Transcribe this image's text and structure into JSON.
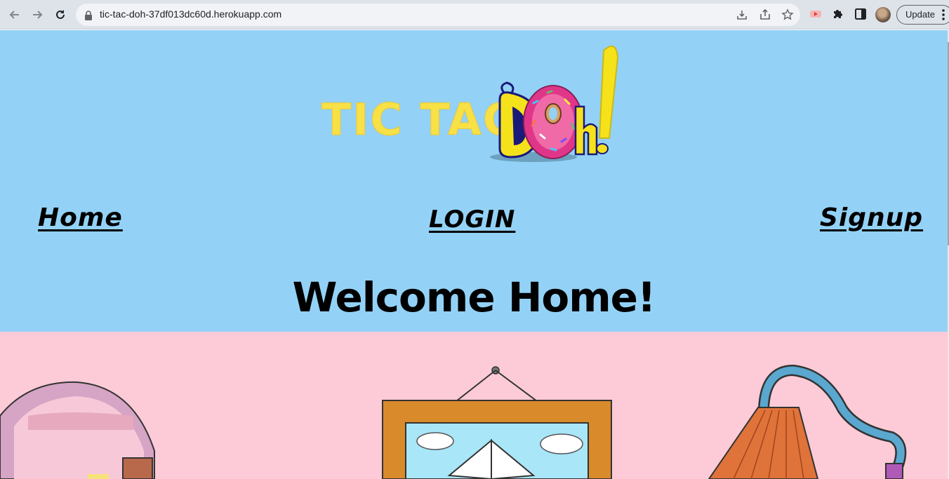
{
  "browser": {
    "url": "tic-tac-doh-37df013dc60d.herokuapp.com",
    "update_label": "Update"
  },
  "logo": {
    "left_text": "TIC TAC",
    "right_text": "DOH!"
  },
  "nav": {
    "home": "Home",
    "login": "LOGIN",
    "signup": "Signup"
  },
  "main": {
    "heading": "Welcome Home!"
  },
  "colors": {
    "header_bg": "#93d2f6",
    "lower_bg": "#fccbd7",
    "logo_yellow": "#f8e047",
    "donut_pink": "#e0368a"
  },
  "icons": [
    "back-icon",
    "forward-icon",
    "reload-icon",
    "lock-icon",
    "install-icon",
    "share-icon",
    "star-icon",
    "extension-icon",
    "puzzle-icon",
    "side-panel-icon",
    "menu-dots-icon"
  ]
}
